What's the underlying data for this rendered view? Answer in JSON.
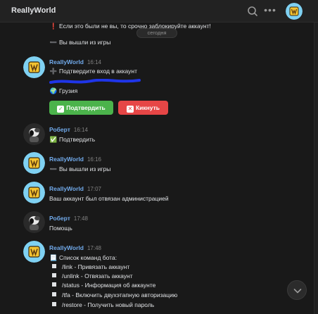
{
  "header": {
    "title": "ReallyWorld",
    "icons": [
      "search-icon",
      "more-icon"
    ]
  },
  "date_chip": "сегодня",
  "messages": {
    "top": {
      "line1": {
        "icon": "❗",
        "text": "Если это были не вы, то срочно заблокируйте аккаунт!"
      },
      "line2": {
        "icon": "➖",
        "text": "Вы вышли из игры"
      }
    },
    "m1": {
      "author": "ReallyWorld",
      "time": "16:14",
      "line1": {
        "icon": "➕",
        "text": "Подтвердите вход в аккаунт"
      },
      "line3": {
        "icon": "🌍",
        "text": "Грузия"
      },
      "buttons": {
        "confirm": "Подтвердить",
        "kick": "Кикнуть"
      }
    },
    "m2": {
      "author": "Роберт",
      "time": "16:14",
      "line1": {
        "icon": "✅",
        "text": "Подтвердить"
      }
    },
    "m3": {
      "author": "ReallyWorld",
      "time": "16:16",
      "line1": {
        "icon": "➖",
        "text": "Вы вышли из игры"
      }
    },
    "m4": {
      "author": "ReallyWorld",
      "time": "17:07",
      "line1": {
        "text": "Ваш аккаунт был отвязан администрацией"
      }
    },
    "m5": {
      "author": "Роберт",
      "time": "17:48",
      "line1": {
        "text": "Помощь"
      }
    },
    "m6": {
      "author": "ReallyWorld",
      "time": "17:48",
      "title": {
        "icon": "📃",
        "text": "Список команд бота:"
      },
      "commands": [
        "/link - Привязать аккаунт",
        "/unlink - Отвязать аккаунт",
        "/status - Информация об аккаунте",
        "/tfa - Включить двухэтапную авторизацию",
        "/restore - Получить новый пароль"
      ]
    }
  },
  "colors": {
    "accent": "#71aaeb",
    "confirm": "#4bb34b",
    "kick": "#e64646",
    "bg": "#191919",
    "scribble": "#1f35e8"
  }
}
